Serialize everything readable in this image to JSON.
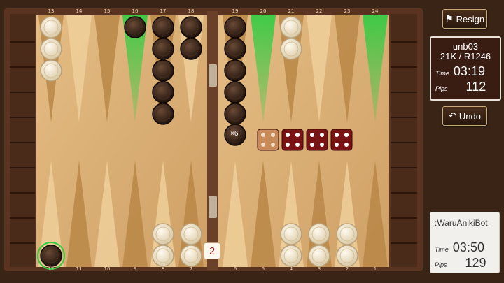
{
  "top_point_labels": [
    "13",
    "14",
    "15",
    "16",
    "17",
    "18",
    "19",
    "20",
    "21",
    "22",
    "23",
    "24"
  ],
  "bottom_point_labels": [
    "12",
    "11",
    "10",
    "9",
    "8",
    "7",
    "6",
    "5",
    "4",
    "3",
    "2",
    "1"
  ],
  "buttons": {
    "resign_label": "Resign",
    "undo_label": "Undo"
  },
  "player1": {
    "name": "unb03",
    "rating": "21K / R1246",
    "time_label": "Time",
    "time": "03:19",
    "pips_label": "Pips",
    "pips": "112"
  },
  "player2": {
    "name": ":WaruAnikiBot",
    "time_label": "Time",
    "time": "03:50",
    "pips_label": "Pips",
    "pips": "129"
  },
  "stack_count": "×6",
  "doubling_cube": "2",
  "dice": [
    {
      "value": 4,
      "color": "light",
      "used": true
    },
    {
      "value": 4,
      "color": "dark",
      "used": false
    },
    {
      "value": 4,
      "color": "dark",
      "used": false
    },
    {
      "value": 4,
      "color": "dark",
      "used": false
    }
  ],
  "checkers": {
    "13": {
      "color": "white",
      "count": 3
    },
    "16": {
      "color": "dark",
      "count": 1
    },
    "17": {
      "color": "dark",
      "count": 5
    },
    "18": {
      "color": "dark",
      "count": 2
    },
    "19": {
      "color": "dark",
      "count": 6
    },
    "21": {
      "color": "white",
      "count": 2
    },
    "12": {
      "color": "dark",
      "count": 1,
      "selected": true
    },
    "8": {
      "color": "white",
      "count": 2
    },
    "7": {
      "color": "white",
      "count": 2
    },
    "4": {
      "color": "white",
      "count": 2
    },
    "3": {
      "color": "white",
      "count": 2
    },
    "2": {
      "color": "white",
      "count": 2
    }
  },
  "highlighted_points": [
    "16",
    "20",
    "24"
  ],
  "colors": {
    "board_light": "#dbb27a",
    "board_dark": "#b88748",
    "frame": "#5a3420",
    "highlight": "#2ecc40",
    "dark_checker": "#3a2418",
    "white_checker": "#f4ead6"
  }
}
